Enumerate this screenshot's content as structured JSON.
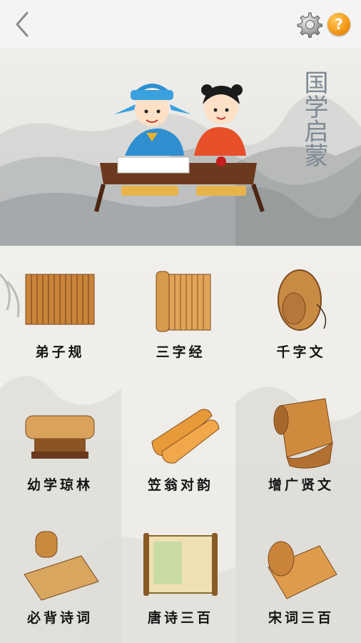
{
  "header": {
    "back_icon": "chevron-left-icon",
    "settings_icon": "gear-icon",
    "help_label": "?"
  },
  "banner": {
    "vertical_title": "国学启蒙"
  },
  "books": [
    {
      "label": "弟子规"
    },
    {
      "label": "三字经"
    },
    {
      "label": "千字文"
    },
    {
      "label": "幼学琼林"
    },
    {
      "label": "笠翁对韵"
    },
    {
      "label": "增广贤文"
    },
    {
      "label": "必背诗词"
    },
    {
      "label": "唐诗三百"
    },
    {
      "label": "宋词三百"
    }
  ],
  "colors": {
    "topbar": "#f4f4f4",
    "help_orange": "#f39a1a",
    "bamboo": "#d08a3c",
    "ink": "#141414"
  }
}
